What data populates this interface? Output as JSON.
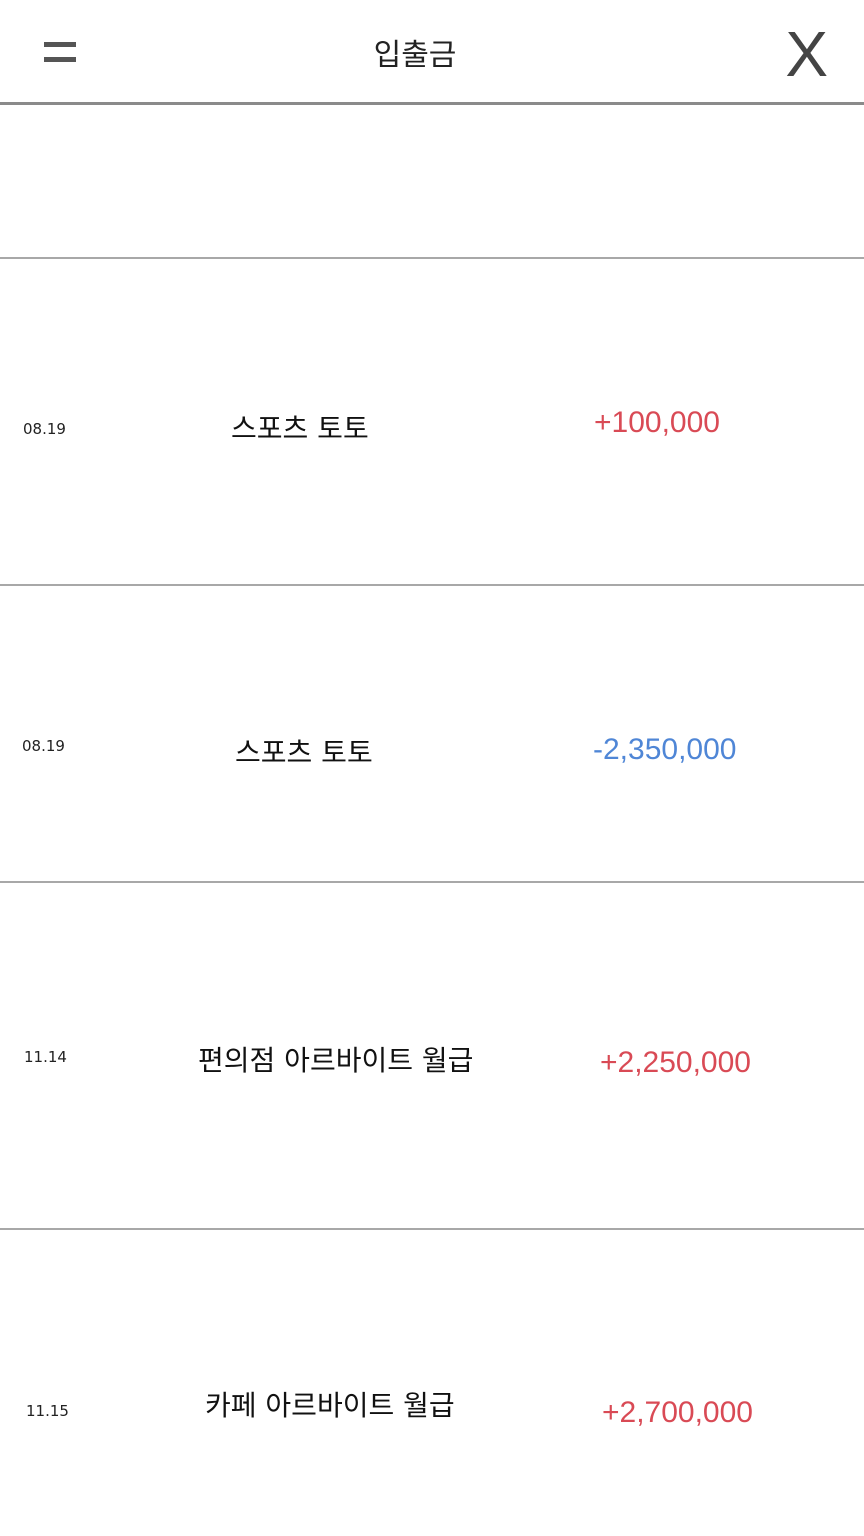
{
  "header": {
    "title": "입출금",
    "close_label": "X",
    "menu_icon": "hamburger-icon"
  },
  "transactions": [
    {
      "date": "08.19",
      "description": "스포츠 토토",
      "amount": "+100,000",
      "type": "deposit"
    },
    {
      "date": "08.19",
      "description": "스포츠 토토",
      "amount": "-2,350,000",
      "type": "withdrawal"
    },
    {
      "date": "11.14",
      "description": "편의점 아르바이트 월급",
      "amount": "+2,250,000",
      "type": "deposit"
    },
    {
      "date": "11.15",
      "description": "카페 아르바이트 월급",
      "amount": "+2,700,000",
      "type": "deposit"
    }
  ],
  "colors": {
    "deposit": "#d94a55",
    "withdrawal": "#4f86d6"
  }
}
